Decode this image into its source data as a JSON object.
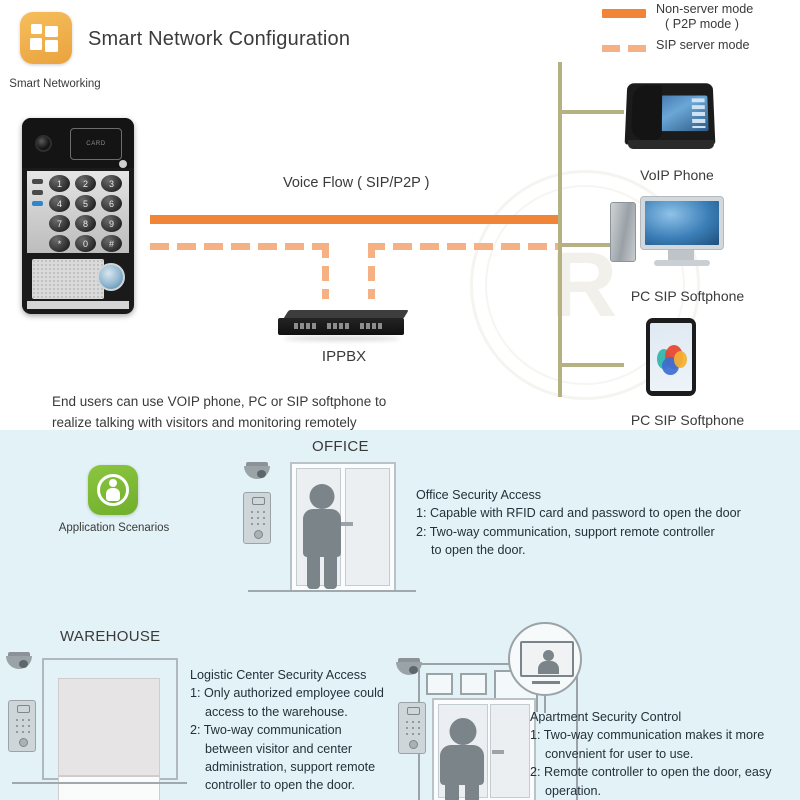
{
  "network_section": {
    "icon_caption": "Smart Networking",
    "title": "Smart Network Configuration",
    "icon_name": "smart-networking-icon",
    "legend": [
      {
        "style": "solid",
        "line1": "Non-server mode",
        "line2": "( P2P mode )",
        "color": "#F08537"
      },
      {
        "style": "dashed",
        "line1": "SIP server mode",
        "line2": "",
        "color": "#F5B183"
      }
    ],
    "voice_flow_label": "Voice Flow ( SIP/P2P )",
    "devices": {
      "door_intercom": {
        "rfid_label": "CARD",
        "keypad": [
          "1",
          "2",
          "3",
          "4",
          "5",
          "6",
          "7",
          "8",
          "9",
          "*",
          "0",
          "#"
        ]
      },
      "voip_phone_label": "VoIP Phone",
      "pc_softphone_label": "PC SIP Softphone",
      "mobile_softphone_label": "PC SIP Softphone",
      "ippbx_label": "IPPBX"
    },
    "note_line1": "End users can use VOIP phone, PC or SIP softphone to",
    "note_line2": "realize talking with visitors and monitoring remotely",
    "watermark_text": "R"
  },
  "application_section": {
    "icon_caption": "Application Scenarios",
    "icon_name": "application-scenarios-icon",
    "scenes": [
      {
        "title": "OFFICE",
        "heading": "Office Security Access",
        "items": [
          "1: Capable with RFID card and password to open the door",
          "2: Two-way communication, support remote controller"
        ],
        "continuation": "to open the door."
      },
      {
        "title": "WAREHOUSE",
        "heading": "Logistic Center Security Access",
        "items": [
          "1: Only authorized employee could",
          "2: Two-way communication"
        ],
        "item1_cont": "access to the warehouse.",
        "item2_cont1": "between visitor and center",
        "item2_cont2": "administration, support remote",
        "item2_cont3": "controller to open the door."
      },
      {
        "title": "",
        "heading": "Apartment Security Control",
        "items": [
          "1: Two-way communication makes it more",
          "2: Remote controller to open the door, easy"
        ],
        "item1_cont": "convenient for user to use.",
        "item2_cont": "operation."
      }
    ]
  },
  "colors": {
    "accent_orange": "#F08537",
    "accent_orange_light": "#F5B183",
    "trunk_olive": "#B5B183",
    "app_bg": "#E3F2F7",
    "icon_orange": "#E9A33E",
    "icon_green": "#8CC63F"
  }
}
